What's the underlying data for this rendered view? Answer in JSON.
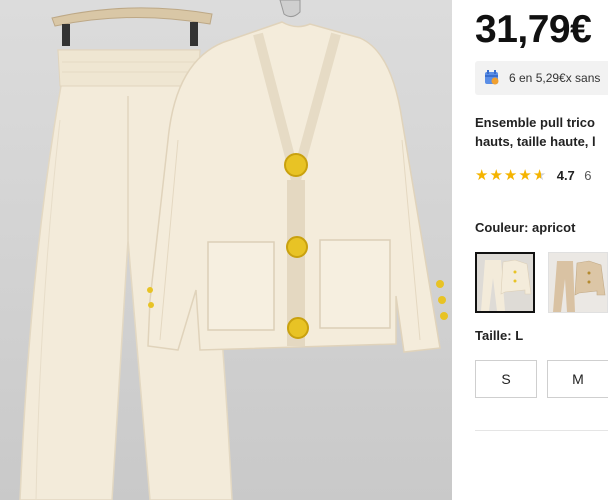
{
  "product": {
    "price": "31,79€",
    "installment_text": "6 en 5,29€x sans",
    "title_lines": [
      "Ensemble pull trico",
      "hauts, taille haute, l"
    ],
    "rating": {
      "value": "4.7",
      "count": "6",
      "stars": 4.7
    },
    "color": {
      "label": "Couleur: apricot",
      "options": [
        "apricot",
        "khaki"
      ],
      "selected": "apricot"
    },
    "size": {
      "label": "Taille: L",
      "options": [
        "S",
        "M"
      ]
    }
  },
  "colors": {
    "accent_star": "#f5b400",
    "garment": "#f2ead8",
    "button_gold": "#e7c223"
  },
  "icons": {
    "installment": "calendar-card-icon",
    "star": "star-icon"
  }
}
